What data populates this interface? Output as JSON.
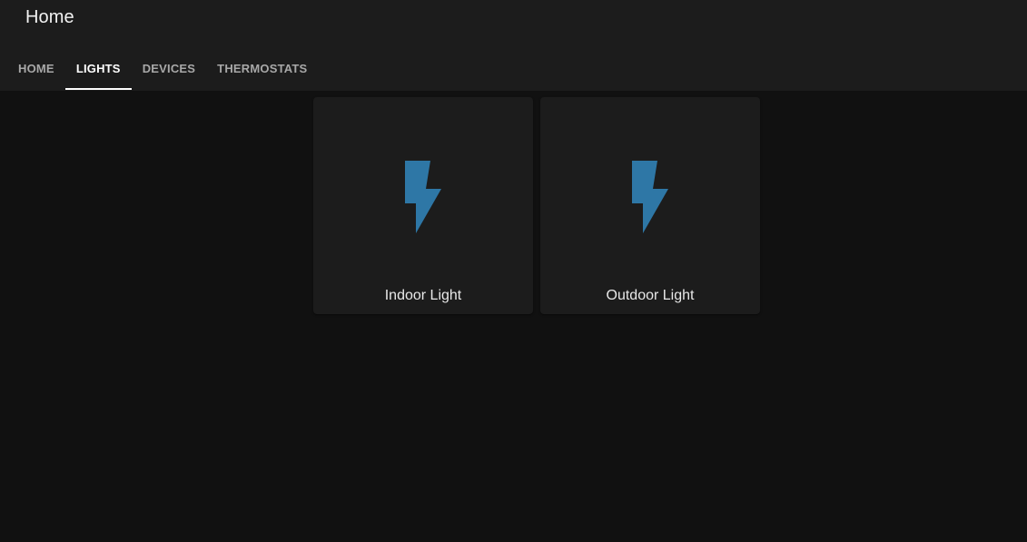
{
  "header": {
    "title": "Home"
  },
  "tabs": [
    {
      "label": "HOME",
      "active": false
    },
    {
      "label": "LIGHTS",
      "active": true
    },
    {
      "label": "DEVICES",
      "active": false
    },
    {
      "label": "THERMOSTATS",
      "active": false
    }
  ],
  "cards": [
    {
      "label": "Indoor Light",
      "icon": "lightning-bolt-icon"
    },
    {
      "label": "Outdoor Light",
      "icon": "lightning-bolt-icon"
    }
  ],
  "colors": {
    "icon": "#2e77a6",
    "background": "#111111",
    "header": "#1c1c1c",
    "card": "#1c1c1c"
  }
}
